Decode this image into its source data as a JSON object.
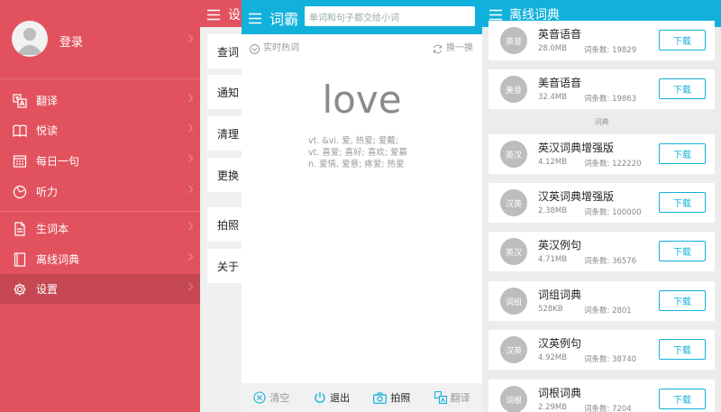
{
  "sidebar": {
    "login_label": "登录",
    "items": [
      {
        "label": "翻译",
        "icon": "translate-icon"
      },
      {
        "label": "悦读",
        "icon": "book-icon"
      },
      {
        "label": "每日一句",
        "icon": "calendar-icon"
      },
      {
        "label": "听力",
        "icon": "listening-icon"
      },
      {
        "label": "生词本",
        "icon": "notebook-icon"
      },
      {
        "label": "离线词典",
        "icon": "dictionary-icon"
      },
      {
        "label": "设置",
        "icon": "gear-icon",
        "active": true
      }
    ]
  },
  "settings": {
    "title": "设置",
    "rows": [
      "查词",
      "通知",
      "清理",
      "更换",
      "拍照",
      "关于"
    ]
  },
  "ciba": {
    "title": "词霸",
    "search_placeholder": "单词和句子都交给小词",
    "hot_label": "实时热词",
    "refresh_label": "换一换",
    "word": "love",
    "definitions": [
      "vt. &vi.  爱, 热爱; 爱戴;",
      "vt.  喜爱; 喜好; 喜欢; 爱慕",
      "n.  爱情, 爱意; 疼爱; 热爱"
    ],
    "bottom": [
      {
        "label": "清空",
        "icon": "clear-icon"
      },
      {
        "label": "退出",
        "icon": "power-icon"
      },
      {
        "label": "拍照",
        "icon": "camera-icon"
      },
      {
        "label": "翻译",
        "icon": "translate-icon"
      }
    ]
  },
  "offline": {
    "title": "离线词典",
    "section_label": "词典",
    "entries_prefix": "词条数: ",
    "download_label": "下载",
    "items": [
      {
        "badge": "英音",
        "name": "英音语音",
        "size": "28.0MB",
        "count": "19829"
      },
      {
        "badge": "美音",
        "name": "美音语音",
        "size": "32.4MB",
        "count": "19863"
      },
      {
        "badge": "英汉",
        "name": "英汉词典增强版",
        "size": "4.12MB",
        "count": "122220"
      },
      {
        "badge": "汉英",
        "name": "汉英词典增强版",
        "size": "2.38MB",
        "count": "100000"
      },
      {
        "badge": "英汉",
        "name": "英汉例句",
        "size": "4.71MB",
        "count": "36576"
      },
      {
        "badge": "词组",
        "name": "词组词典",
        "size": "528KB",
        "count": "2801"
      },
      {
        "badge": "汉英",
        "name": "汉英例句",
        "size": "4.92MB",
        "count": "38740"
      },
      {
        "badge": "词根",
        "name": "词根词典",
        "size": "2.29MB",
        "count": "7204"
      }
    ]
  },
  "colors": {
    "sidebar": "#e2525e",
    "accent": "#12b1db"
  }
}
